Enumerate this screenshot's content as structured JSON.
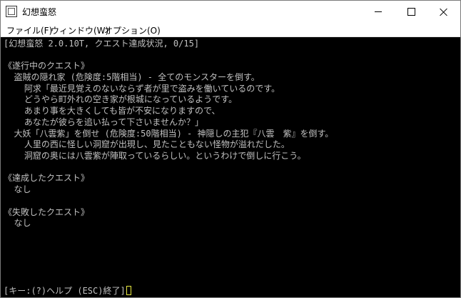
{
  "window": {
    "title": "幻想蛮怒",
    "icon": "app-icon",
    "controls": [
      "minimize-icon",
      "maximize-icon",
      "close-icon"
    ]
  },
  "menu": {
    "file": "ファイル(F)",
    "window": "ウィンドウ(W)",
    "options": "オプション(O)"
  },
  "console": {
    "header": "[幻想蛮怒 2.0.10T, クエスト達成状況, 0/15]",
    "in_progress": {
      "heading": "《遂行中のクエスト》",
      "quests": [
        {
          "title": "  盗賊の隠れ家 (危険度:5階相当) - 全てのモンスターを倒す。",
          "desc": [
            "    阿求「最近見覚えのないならず者が里で盗みを働いているのです。",
            "    どうやら町外れの空き家が根城になっているようです。",
            "    あまり事を大きくしても皆が不安になりますので、",
            "    あなたが彼らを追い払って下さいませんか？」"
          ]
        },
        {
          "title": "  大妖「八雲紫」を倒せ (危険度:50階相当) - 神隠しの主犯『八雲　紫』を倒す。",
          "desc": [
            "    人里の西に怪しい洞窟が出現し、見たこともない怪物が溢れだした。",
            "    洞窟の奥には八雲紫が陣取っているらしい。というわけで倒しに行こう。"
          ]
        }
      ]
    },
    "completed": {
      "heading": "《達成したクエスト》",
      "none": "  なし"
    },
    "failed": {
      "heading": "《失敗したクエスト》",
      "none": "  なし"
    },
    "prompt": "[キー:(?)ヘルプ (ESC)終了]"
  }
}
